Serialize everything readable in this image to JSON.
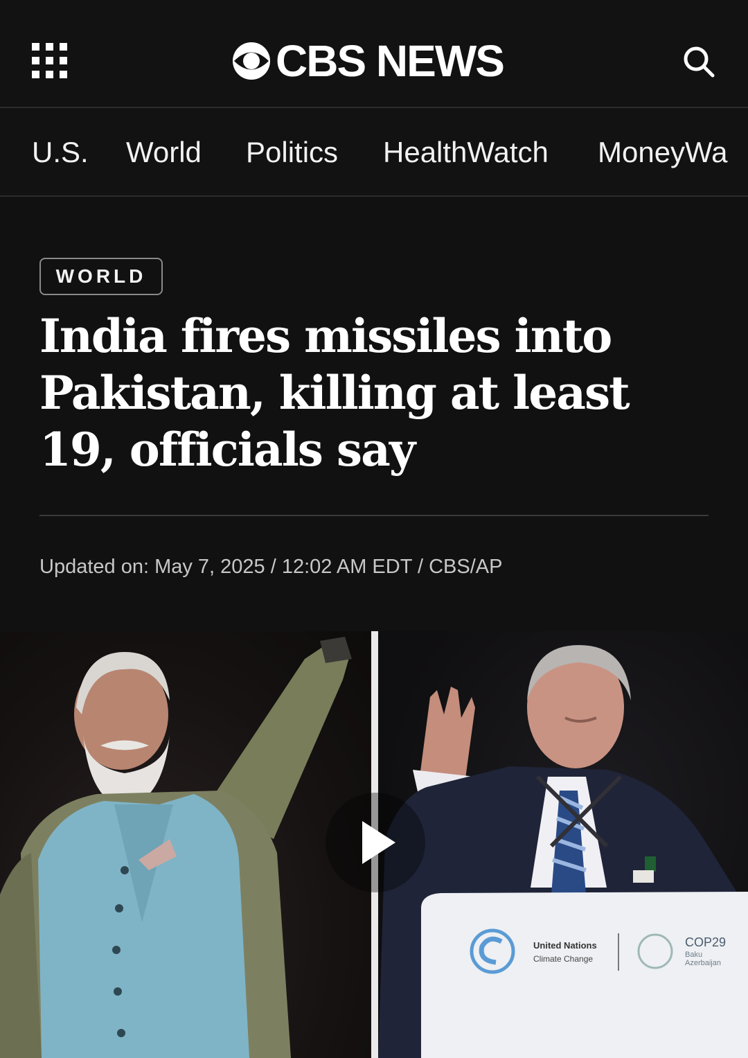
{
  "header": {
    "brand": "CBS NEWS",
    "menu_icon": "grid-menu-icon",
    "search_icon": "search-icon"
  },
  "nav": {
    "items": [
      "U.S.",
      "World",
      "Politics",
      "HealthWatch",
      "MoneyWa"
    ]
  },
  "article": {
    "section_badge": "WORLD",
    "headline": "India fires missiles into Pakistan, killing at least 19, officials say",
    "meta": "Updated on: May 7, 2025 / 12:02 AM EDT / CBS/AP"
  },
  "media": {
    "play_icon": "play-icon",
    "podium_org": "United Nations",
    "podium_org_sub": "Climate Change",
    "podium_event": "COP29",
    "podium_event_city": "Baku",
    "podium_event_country": "Azerbaijan"
  },
  "colors": {
    "background": "#111112",
    "text": "#ffffff",
    "muted_text": "#c8c8c8",
    "divider": "#2c2c2c"
  }
}
